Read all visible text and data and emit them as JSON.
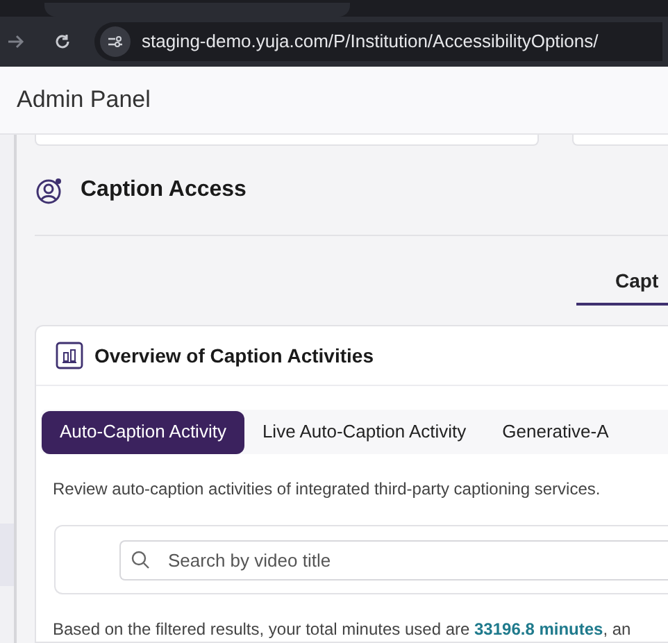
{
  "browser": {
    "url": "staging-demo.yuja.com/P/Institution/AccessibilityOptions/"
  },
  "header": {
    "title": "Admin Panel"
  },
  "section": {
    "title": "Caption Access"
  },
  "page_tabs": [
    {
      "label": "Capt",
      "selected": true
    }
  ],
  "card": {
    "title": "Overview of Caption Activities",
    "tabs": [
      {
        "label": "Auto-Caption Activity",
        "selected": true
      },
      {
        "label": "Live Auto-Caption Activity",
        "selected": false
      },
      {
        "label": "Generative-A",
        "selected": false
      }
    ],
    "description": "Review auto-caption activities of integrated third-party captioning services.",
    "search": {
      "placeholder": "Search by video title"
    },
    "summary": {
      "before": "Based on the filtered results, your total minutes used are ",
      "highlight": "33196.8 minutes",
      "after": ", an"
    }
  }
}
